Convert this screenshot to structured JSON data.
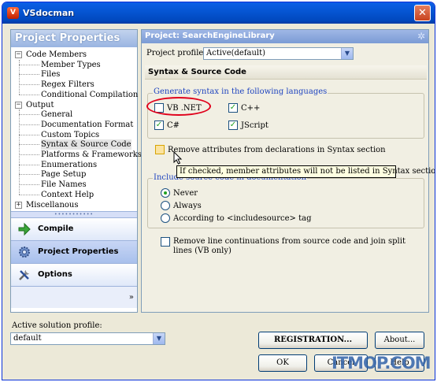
{
  "window": {
    "title": "VSdocman",
    "close_glyph": "✕"
  },
  "left_panel": {
    "header": "Project Properties",
    "tree": [
      {
        "label": "Code Members",
        "level": 0,
        "toggle": "−"
      },
      {
        "label": "Member Types",
        "level": 1
      },
      {
        "label": "Files",
        "level": 1
      },
      {
        "label": "Regex Filters",
        "level": 1
      },
      {
        "label": "Conditional Compilation",
        "level": 1
      },
      {
        "label": "Output",
        "level": 0,
        "toggle": "−"
      },
      {
        "label": "General",
        "level": 1
      },
      {
        "label": "Documentation Format",
        "level": 1
      },
      {
        "label": "Custom Topics",
        "level": 1
      },
      {
        "label": "Syntax & Source Code",
        "level": 1,
        "selected": true
      },
      {
        "label": "Platforms & Frameworks",
        "level": 1
      },
      {
        "label": "Enumerations",
        "level": 1
      },
      {
        "label": "Page Setup",
        "level": 1
      },
      {
        "label": "File Names",
        "level": 1
      },
      {
        "label": "Context Help",
        "level": 1
      },
      {
        "label": "Miscellanous",
        "level": 0,
        "toggle": "+"
      }
    ],
    "grip": "•••••••••••",
    "nav": [
      {
        "label": "Compile",
        "icon": "compile-arrow-icon"
      },
      {
        "label": "Project Properties",
        "icon": "gear-icon",
        "active": true
      },
      {
        "label": "Options",
        "icon": "tools-icon"
      }
    ],
    "more_glyph": "»"
  },
  "right_panel": {
    "header": "Project: SearchEngineLibrary",
    "profile_label": "Project profile:",
    "profile_value": "Active(default)",
    "section_title": "Syntax & Source Code",
    "languages_legend": "Generate syntax in the following languages",
    "languages": [
      {
        "label": "VB .NET",
        "checked": false
      },
      {
        "label": "C++",
        "checked": true
      },
      {
        "label": "C#",
        "checked": true
      },
      {
        "label": "JScript",
        "checked": true
      }
    ],
    "remove_attributes_label": "Remove attributes from declarations in Syntax section",
    "tooltip": "If checked, member attributes will not be listed in Syntax section",
    "include_legend": "Include source code in documentation",
    "include_options": [
      {
        "label": "Never",
        "selected": true
      },
      {
        "label": "Always",
        "selected": false
      },
      {
        "label": "According to <includesource> tag",
        "selected": false
      }
    ],
    "remove_continuations_label": "Remove line continuations from source code and join split lines (VB only)",
    "check_glyph": "✓"
  },
  "bottom": {
    "active_profile_label": "Active solution profile:",
    "active_profile_value": "default",
    "registration_label": "REGISTRATION...",
    "about_label": "About...",
    "ok_label": "OK",
    "cancel_label": "Cancel",
    "help_label": "Help"
  },
  "watermark": "ITMOP.COM",
  "colors": {
    "titlebar": "#0656d4",
    "accent_blue": "#1f44bf",
    "check_green": "#21a121",
    "highlight_red": "#e0001b"
  }
}
